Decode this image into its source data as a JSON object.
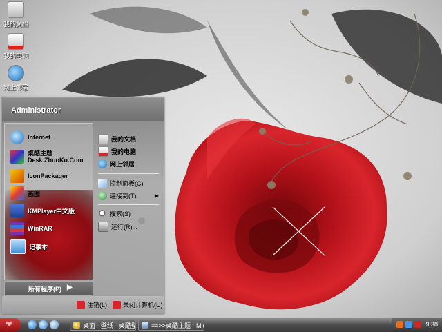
{
  "desktop": {
    "icons": [
      {
        "label": "我的文档"
      },
      {
        "label": "我的电脑"
      },
      {
        "label": "网上邻居"
      }
    ]
  },
  "start_menu": {
    "user": "Administrator",
    "left_items": [
      {
        "line1": "Internet",
        "line2": ""
      },
      {
        "line1": "桌酷主题",
        "line2": "Desk.ZhuoKu.Com"
      },
      {
        "line1": "IconPackager",
        "line2": ""
      },
      {
        "line1": "画图",
        "line2": ""
      },
      {
        "line1": "KMPlayer中文版",
        "line2": ""
      },
      {
        "line1": "WinRAR",
        "line2": ""
      },
      {
        "line1": "记事本",
        "line2": ""
      }
    ],
    "all_programs": "所有程序(P)",
    "all_programs_arrow": "▶",
    "right_items": [
      {
        "label": "我的文档"
      },
      {
        "label": "我的电脑"
      },
      {
        "label": "网上邻居"
      },
      {
        "label": "控制面板(C)"
      },
      {
        "label": "连接到(T)"
      },
      {
        "label": "搜索(S)"
      },
      {
        "label": "运行(R)..."
      }
    ],
    "log_off": "注销(L)",
    "shut_down": "关闭计算机(U)"
  },
  "taskbar": {
    "tasks": [
      {
        "label": "桌面 - 壁纸 - 桌酷壁..."
      },
      {
        "label": "==>>桌酷主题 - Mic..."
      }
    ],
    "clock": "9:38"
  },
  "colors": {
    "rose": "#c0141c",
    "taskbar": "#3a3a3a",
    "menu_gray": "#8d8d8d"
  }
}
